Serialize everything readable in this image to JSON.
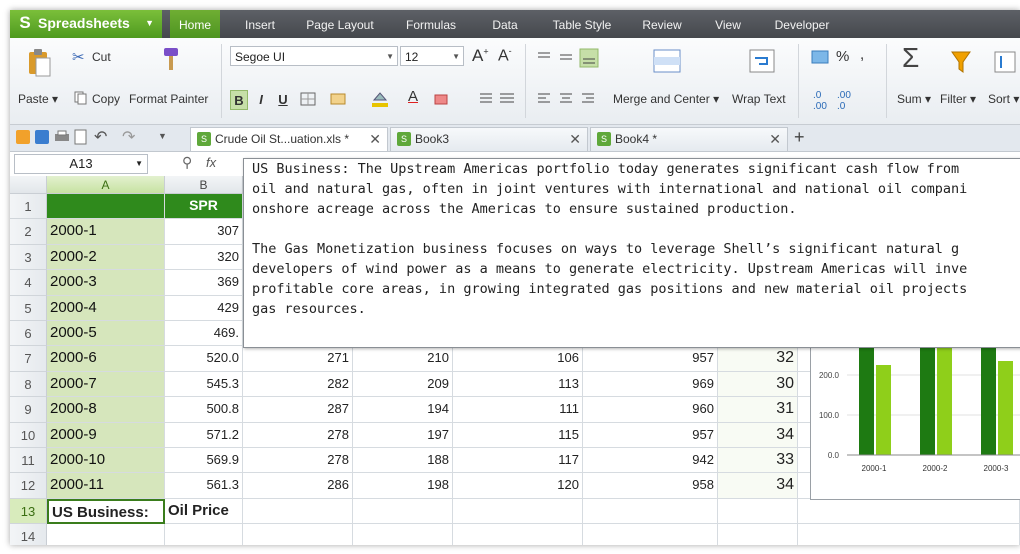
{
  "app": {
    "name": "Spreadsheets"
  },
  "menu": [
    "Home",
    "Insert",
    "Page Layout",
    "Formulas",
    "Data",
    "Table Style",
    "Review",
    "View",
    "Developer"
  ],
  "ribbon": {
    "paste": "Paste",
    "cut": "Cut",
    "copy": "Copy",
    "format_painter": "Format Painter",
    "font_name": "Segoe UI",
    "font_size": "12",
    "bold": "B",
    "italic": "I",
    "underline": "U",
    "merge_center": "Merge and Center",
    "wrap_text": "Wrap Text",
    "percent": "%",
    "sum": "Sum",
    "filter": "Filter",
    "sort": "Sort"
  },
  "tabs": [
    {
      "label": "Crude Oil St...uation.xls *"
    },
    {
      "label": "Book3"
    },
    {
      "label": "Book4 *"
    }
  ],
  "formula_bar": {
    "cell_ref": "A13",
    "fx": "fx"
  },
  "columns": [
    "A",
    "B"
  ],
  "rows": [
    {
      "num": "1",
      "a": "",
      "b": "SPR",
      "vals": []
    },
    {
      "num": "2",
      "a": "2000-1",
      "b": "307",
      "vals": []
    },
    {
      "num": "3",
      "a": "2000-2",
      "b": "320",
      "vals": []
    },
    {
      "num": "4",
      "a": "2000-3",
      "b": "369",
      "vals": []
    },
    {
      "num": "5",
      "a": "2000-4",
      "b": "429",
      "vals": []
    },
    {
      "num": "6",
      "a": "2000-5",
      "b": "469.",
      "vals": []
    },
    {
      "num": "7",
      "a": "2000-6",
      "b": "520.0",
      "vals": [
        "271",
        "210",
        "106",
        "957",
        "32"
      ]
    },
    {
      "num": "8",
      "a": "2000-7",
      "b": "545.3",
      "vals": [
        "282",
        "209",
        "113",
        "969",
        "30"
      ]
    },
    {
      "num": "9",
      "a": "2000-8",
      "b": "500.8",
      "vals": [
        "287",
        "194",
        "111",
        "960",
        "31"
      ]
    },
    {
      "num": "10",
      "a": "2000-9",
      "b": "571.2",
      "vals": [
        "278",
        "197",
        "115",
        "957",
        "34"
      ]
    },
    {
      "num": "11",
      "a": "2000-10",
      "b": "569.9",
      "vals": [
        "278",
        "188",
        "117",
        "942",
        "33"
      ]
    },
    {
      "num": "12",
      "a": "2000-11",
      "b": "561.3",
      "vals": [
        "286",
        "198",
        "120",
        "958",
        "34"
      ]
    },
    {
      "num": "13",
      "a": "US Business: ",
      "b": "Oil Price",
      "vals": []
    },
    {
      "num": "14",
      "a": "",
      "b": "",
      "vals": []
    }
  ],
  "popup": {
    "para1": "US Business: The Upstream Americas portfolio today generates significant cash flow from\noil and natural gas, often in joint ventures with international and national oil compani\nonshore acreage across the Americas to ensure sustained production.",
    "para2": "The Gas Monetization business focuses on ways to leverage Shell’s significant natural g\ndevelopers of wind power as a means to generate electricity. Upstream Americas will inve\nprofitable core areas, in growing integrated gas positions and new material oil projects\ngas resources."
  },
  "chart_data": {
    "type": "bar",
    "categories": [
      "2000-1",
      "2000-2",
      "2000-3"
    ],
    "series": [
      {
        "values": [
          420,
          420,
          420
        ],
        "color": "#1e7a12"
      },
      {
        "values": [
          225,
          280,
          235
        ],
        "color": "#8fcf1a"
      }
    ],
    "ytick_labels": [
      "0.0",
      "100.0",
      "200.0"
    ],
    "ylim": [
      0,
      300
    ]
  }
}
